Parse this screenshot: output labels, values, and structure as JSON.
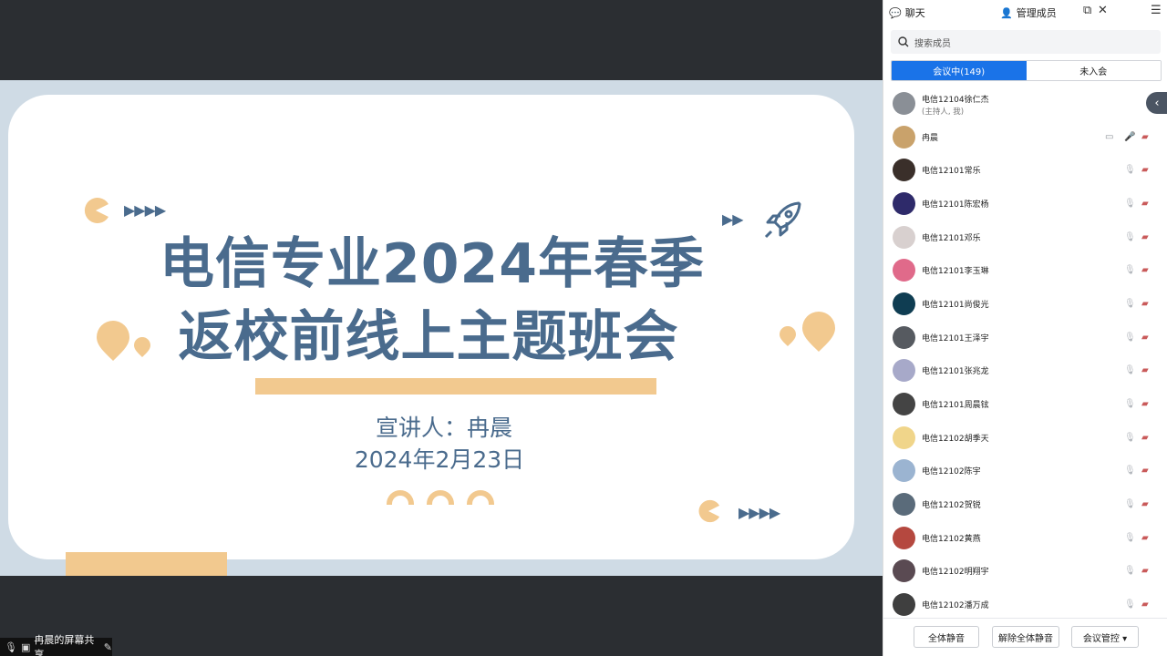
{
  "slide": {
    "title_line1": "电信专业2024年春季",
    "title_line2": "返校前线上主题班会",
    "speaker": "宣讲人：冉晨",
    "date": "2024年2月23日",
    "colors": {
      "accent": "#4a6b8d",
      "orange": "#f2c98f",
      "background": "#cfdbe5"
    }
  },
  "share_tag": {
    "label": "冉晨的屏幕共享"
  },
  "panel": {
    "tabs": {
      "chat": "聊天",
      "members": "管理成员"
    },
    "search": {
      "placeholder": "搜索成员"
    },
    "segments": {
      "in_meeting": "会议中(149)",
      "not_joined": "未入会"
    },
    "members": [
      {
        "name": "电信12104徐仁杰",
        "sub": "(主持人, 我)",
        "avatar_color": "#8a8f96"
      },
      {
        "name": "冉晨",
        "avatar_color": "#c9a26b",
        "sharing": true
      },
      {
        "name": "电信12101常乐",
        "avatar_color": "#3a2f2a"
      },
      {
        "name": "电信12101陈宏杨",
        "avatar_color": "#2e2a6a"
      },
      {
        "name": "电信12101邓乐",
        "avatar_color": "#d8d0cf"
      },
      {
        "name": "电信12101李玉琳",
        "avatar_color": "#e06a8a"
      },
      {
        "name": "电信12101尚俊光",
        "avatar_color": "#0f3d52"
      },
      {
        "name": "电信12101王泽宇",
        "avatar_color": "#565a60"
      },
      {
        "name": "电信12101张兆龙",
        "avatar_color": "#a7a9c9"
      },
      {
        "name": "电信12101周晨铉",
        "avatar_color": "#444"
      },
      {
        "name": "电信12102胡季天",
        "avatar_color": "#f0d58a"
      },
      {
        "name": "电信12102陈宇",
        "avatar_color": "#9bb4d1"
      },
      {
        "name": "电信12102贺锐",
        "avatar_color": "#5a6b7a"
      },
      {
        "name": "电信12102黄燕",
        "avatar_color": "#b5483f"
      },
      {
        "name": "电信12102明翔宇",
        "avatar_color": "#5a4a52"
      },
      {
        "name": "电信12102潘万成",
        "avatar_color": "#3f3f3f"
      }
    ],
    "footer": {
      "mute_all": "全体静音",
      "unmute_all": "解除全体静音",
      "control": "会议管控 ▾"
    }
  }
}
